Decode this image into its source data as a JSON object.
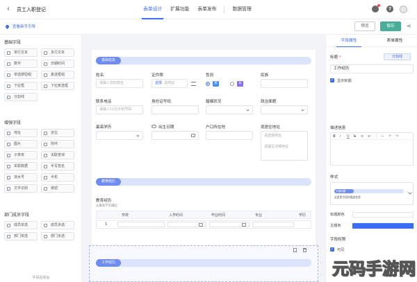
{
  "header": {
    "title": "员工入职登记",
    "tabs": [
      "表单设计",
      "扩展功能",
      "表单发布",
      "数据管理"
    ],
    "active_tab": 0
  },
  "subbar": {
    "guide": "查看新手引导",
    "preview_label": "预览",
    "save_label": "保存"
  },
  "left_panel": {
    "groups": [
      {
        "title": "基础字段",
        "items": [
          {
            "label": "单行文本",
            "icon": "text-icon"
          },
          {
            "label": "多行文本",
            "icon": "multiline-icon"
          },
          {
            "label": "数字",
            "icon": "number-icon"
          },
          {
            "label": "日期时间",
            "icon": "calendar-icon"
          },
          {
            "label": "单选按钮组",
            "icon": "radio-icon"
          },
          {
            "label": "复选框组",
            "icon": "checkbox-icon"
          },
          {
            "label": "下拉框",
            "icon": "dropdown-icon"
          },
          {
            "label": "下拉复选框",
            "icon": "dropdown-multi-icon"
          },
          {
            "label": "分割线",
            "icon": "divider-icon"
          }
        ]
      },
      {
        "title": "增强字段",
        "items": [
          {
            "label": "地址",
            "icon": "location-icon"
          },
          {
            "label": "定位",
            "icon": "gps-icon"
          },
          {
            "label": "图片",
            "icon": "image-icon"
          },
          {
            "label": "附件",
            "icon": "attachment-icon"
          },
          {
            "label": "子表单",
            "icon": "subform-icon"
          },
          {
            "label": "关联查询",
            "icon": "link-query-icon"
          },
          {
            "label": "关联数据",
            "icon": "link-data-icon"
          },
          {
            "label": "手写签名",
            "icon": "signature-icon"
          },
          {
            "label": "流水号",
            "icon": "serial-icon"
          },
          {
            "label": "手机",
            "icon": "phone-icon"
          },
          {
            "label": "文字识别",
            "icon": "ocr-icon"
          },
          {
            "label": "按钮",
            "icon": "button-icon"
          }
        ]
      },
      {
        "title": "部门成员字段",
        "items": [
          {
            "label": "成员单选",
            "icon": "member-icon"
          },
          {
            "label": "成员多选",
            "icon": "members-icon"
          },
          {
            "label": "部门单选",
            "icon": "department-icon"
          },
          {
            "label": "部门多选",
            "icon": "departments-icon"
          }
        ]
      }
    ],
    "footer": "字段回收站"
  },
  "canvas": {
    "section1": "基础信息",
    "fields": {
      "name_label": "姓名",
      "name_placeholder": "请输入您的姓名",
      "id_label": "证件照",
      "id_button": "选择",
      "id_hint": "请将证",
      "gender_label": "性别",
      "gender_male": "男",
      "gender_female": "女",
      "ethnic_label": "民族",
      "phone_label": "联系电话",
      "phone_placeholder": "请输入11位手机号码",
      "idno_label": "身份证号码",
      "marital_label": "婚姻状况",
      "political_label": "政治面貌",
      "edu_label": "最高学历",
      "birth_label": "出生日期",
      "hukou_label": "户口所在地",
      "address_label": "现居住地址",
      "address_placeholder1": "请选择地址",
      "address_placeholder2": "请填写详细地址"
    },
    "section2": "教育经历",
    "edu_table": {
      "title": "教育经历",
      "subtitle": "从最高学历填起",
      "columns": [
        "学校",
        "入学时间",
        "毕业时间",
        "专业",
        "学历"
      ],
      "rows": [
        [
          "1",
          "",
          "",
          "",
          ""
        ]
      ]
    },
    "section3": "工作经历"
  },
  "right_panel": {
    "tabs": [
      "字段属性",
      "表单属性"
    ],
    "title_label": "标题",
    "title_value": "工作经历",
    "format_button": "分割线",
    "show_title": "显示标题",
    "desc_label": "描述信息",
    "editor_tools": [
      "B",
      "I",
      "U",
      "S",
      "≡",
      "≡",
      "⋮",
      "⌁",
      "↶",
      "↷"
    ],
    "style_label": "样式",
    "style_pill": "字段标题",
    "style_sub": "这里是字段的描述信息",
    "title_color_label": "标题颜色",
    "theme_color_label": "主题色",
    "theme_color": "#3b6cf6",
    "perm_label": "字段权限",
    "visible_label": "可见"
  },
  "watermark": "元码手游网",
  "colors": {
    "accent": "#3b6cf6",
    "save": "#4aad9a",
    "section": "#6f8cf3"
  }
}
